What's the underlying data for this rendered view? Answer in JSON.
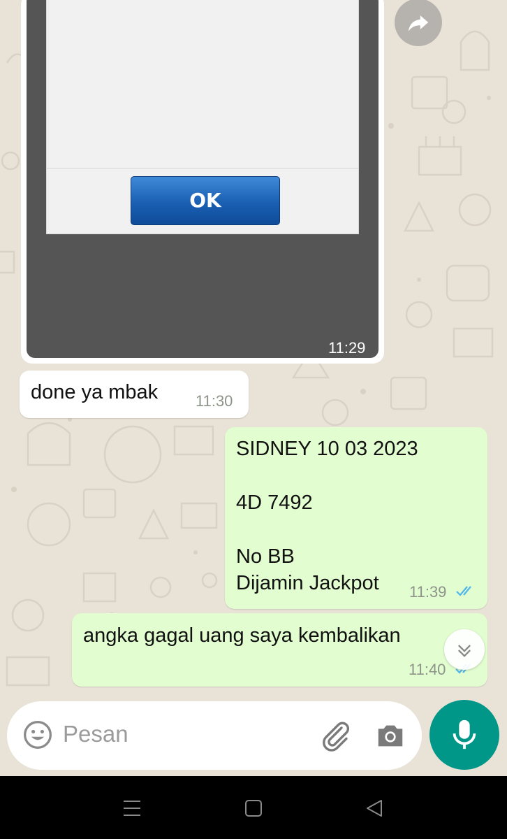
{
  "image_message": {
    "dialog_button_label": "OK",
    "time": "11:29"
  },
  "messages": [
    {
      "direction": "incoming",
      "text": "done ya mbak",
      "time": "11:30"
    },
    {
      "direction": "outgoing",
      "lines": [
        "SIDNEY 10 03 2023",
        "",
        "4D 7492",
        "",
        "No BB",
        "Dijamin Jackpot"
      ],
      "time": "11:39",
      "status": "read"
    },
    {
      "direction": "outgoing",
      "text": "angka gagal uang saya kembalikan",
      "time": "11:40",
      "status": "read"
    }
  ],
  "composer": {
    "placeholder": "Pesan",
    "icons": [
      "emoji-icon",
      "attach-icon",
      "camera-icon",
      "mic-icon"
    ]
  },
  "icons": {
    "forward": "forward-icon",
    "scroll_down": "double-chevron-down-icon"
  },
  "nav": [
    "menu-icon",
    "home-icon",
    "back-icon"
  ],
  "colors": {
    "outgoing_bubble": "#e2fdd0",
    "incoming_bubble": "#ffffff",
    "read_ticks": "#4fb6ec",
    "mic_button": "#009688",
    "wallpaper": "#e9e2d7"
  }
}
